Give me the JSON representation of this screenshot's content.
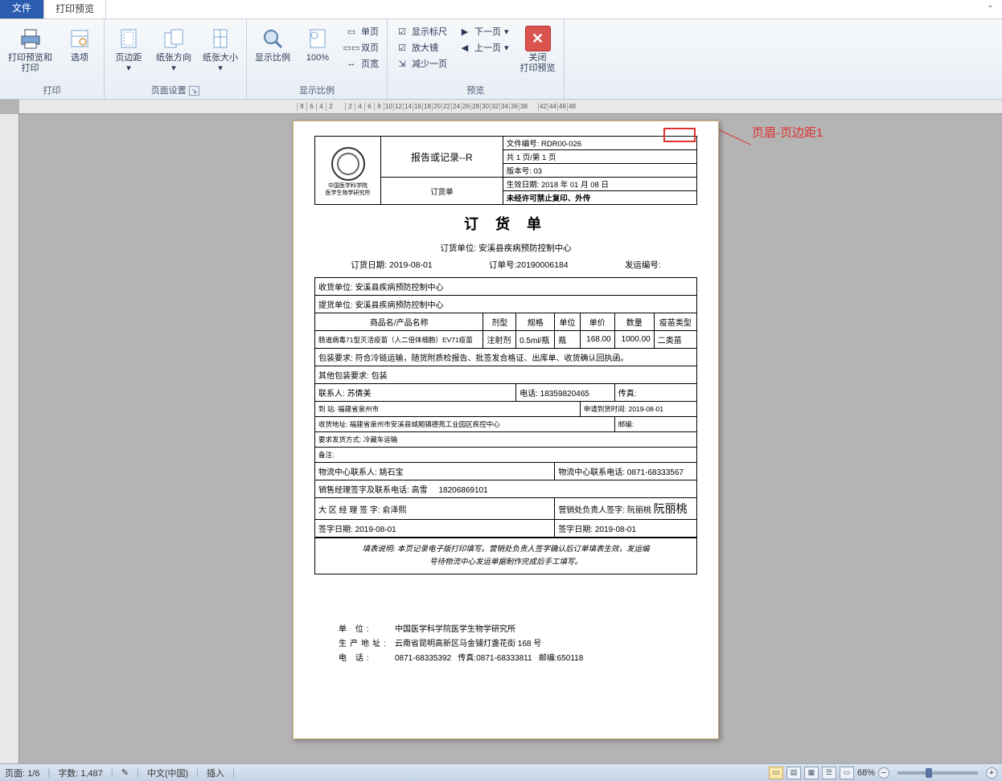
{
  "tabs": {
    "file": "文件",
    "preview": "打印预览"
  },
  "ribbon": {
    "print_preview_print": "打印预览和\n打印",
    "options": "选项",
    "group_print": "打印",
    "margins": "页边距",
    "orientation": "纸张方向",
    "size": "纸张大小",
    "group_page_setup": "页面设置",
    "show_ratio": "显示比例",
    "hundred": "100%",
    "single_page": "单页",
    "double_page": "双页",
    "page_width": "页宽",
    "group_show_ratio": "显示比例",
    "show_ruler": "显示标尺",
    "magnifier": "放大镜",
    "less_one": "减少一页",
    "next_page": "下一页",
    "prev_page": "上一页",
    "close_preview": "关闭\n打印预览",
    "group_preview": "预览"
  },
  "annotation": {
    "text": "页眉-页边距1"
  },
  "ruler_marks": [
    "8",
    "6",
    "4",
    "2",
    "",
    "2",
    "4",
    "6",
    "8",
    "10",
    "12",
    "14",
    "16",
    "18",
    "20",
    "22",
    "24",
    "26",
    "28",
    "30",
    "32",
    "34",
    "36",
    "38",
    "",
    "42",
    "44",
    "46",
    "48"
  ],
  "doc": {
    "hdr": {
      "report_title": "报告或记录--R",
      "order_form": "订货单",
      "file_no_k": "文件编号:",
      "file_no_v": "RDR00-026",
      "pages": "共 1 页/第 1 页",
      "ver_k": "版本号:",
      "ver_v": "03",
      "eff_k": "生效日期:",
      "eff_v": "2018 年 01 月 08 日",
      "restrict": "未经许可禁止复印、外传",
      "org1": "中国医学科学院",
      "org2": "医学生物学研究所"
    },
    "title": "订 货 单",
    "order_unit_k": "订货单位:",
    "order_unit_v": "安溪县疾病预防控制中心",
    "order_date_k": "订货日期:",
    "order_date_v": "2019-08-01",
    "order_no_k": "订单号:",
    "order_no_v": "20190006184",
    "ship_no_k": "发运编号:",
    "recv_unit_k": "收货单位:",
    "recv_unit_v": "安溪县疾病预防控制中心",
    "pick_unit_k": "提货单位:",
    "pick_unit_v": "安溪县疾病预防控制中心",
    "cols": {
      "name": "商品名/产品名称",
      "form": "剂型",
      "spec": "规格",
      "unit": "单位",
      "price": "单价",
      "qty": "数量",
      "vtype": "疫苗类型"
    },
    "row": {
      "name": "肠道病毒71型灭活疫苗（人二倍体细胞）EV71疫苗",
      "form": "注射剂",
      "spec": "0.5ml/瓶",
      "unit": "瓶",
      "price": "168.00",
      "qty": "1000.00",
      "vtype": "二类苗"
    },
    "pack_req_k": "包装要求:",
    "pack_req_v": "符合冷链运输，随货附质检报告、批签发合格证、出库单、收货确认回执函。",
    "other_pack_k": "其他包装要求:",
    "other_pack_v": "包装",
    "contact_k": "联系人:",
    "contact_v": "苏倩美",
    "tel_k": "电话:",
    "tel_v": "18359820465",
    "fax_k": "传真:",
    "to_k": "到    站:",
    "to_v": "福建省泉州市",
    "arrive_k": "申请到货时间:",
    "arrive_v": "2019-08-01",
    "addr_k": "收货地址:",
    "addr_v": "福建省泉州市安溪县城厢镇德苑工业园区疾控中心",
    "post_k": "邮编:",
    "ship_mode_k": "要求发货方式:",
    "ship_mode_v": "冷藏车运输",
    "remark_k": "备注:",
    "log_contact_k": "物流中心联系人:",
    "log_contact_v": "姚石宝",
    "log_tel_k": "物流中心联系电话:",
    "log_tel_v": "0871-68333567",
    "sales_mgr_k": "销售经理签字及联系电话:",
    "sales_mgr_v": "高雪",
    "sales_mgr_tel": "18206869101",
    "region_mgr_k": "大 区 经 理 签 字:",
    "region_mgr_v": "俞泽熙",
    "sales_head_k": "营销处负责人签字:",
    "sales_head_v": "阮丽桃",
    "sign_date_k": "签字日期:",
    "sign_date_v": "2019-08-01",
    "note1": "填表说明: 本页记录电子版打印填写。营销处负责人签字确认后订单填表生效，发运编",
    "note2": "号待物流中心发运单据制作完成后手工填写。",
    "f_unit_k": "单      位:",
    "f_unit_v": "中国医学科学院医学生物学研究所",
    "f_addr_k": "生产地址:",
    "f_addr_v": "云南省昆明高新区马金铺灯盏花街 168 号",
    "f_tel_k": "电      话:",
    "f_tel_v": "0871-68335392",
    "f_fax_k": "传真:",
    "f_fax_v": "0871-68333811",
    "f_post_k": "邮编:",
    "f_post_v": "650118"
  },
  "status": {
    "page": "页面: 1/6",
    "words": "字数: 1,487",
    "lang": "中文(中国)",
    "mode": "插入",
    "zoom": "68%"
  }
}
